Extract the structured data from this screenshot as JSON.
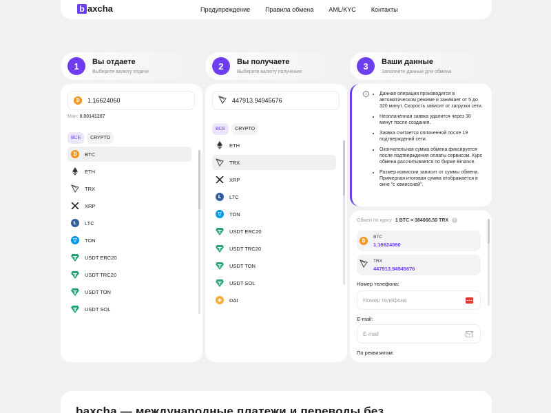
{
  "header": {
    "logo_letter": "b",
    "logo_rest": "axcha",
    "nav": [
      "Предупреждение",
      "Правила обмена",
      "AML/KYC",
      "Контакты"
    ]
  },
  "steps": [
    {
      "num": "1",
      "title": "Вы отдаете",
      "sub": "Выберите валюту отдачи"
    },
    {
      "num": "2",
      "title": "Вы получаете",
      "sub": "Выберите валюту получения"
    },
    {
      "num": "3",
      "title": "Ваши данные",
      "sub": "Заполните данные для обмена"
    }
  ],
  "give": {
    "amount": "1.16624060",
    "min_label": "Мин:",
    "min_value": "0.00141207",
    "filters": [
      "ВСЕ",
      "CRYPTO"
    ],
    "coins": [
      "BTC",
      "ETH",
      "TRX",
      "XRP",
      "LTC",
      "TON",
      "USDT ERC20",
      "USDT TRC20",
      "USDT TON",
      "USDT SOL"
    ]
  },
  "receive": {
    "amount": "447913.94945676",
    "filters": [
      "ВСЕ",
      "CRYPTO"
    ],
    "coins": [
      "ETH",
      "TRX",
      "XRP",
      "LTC",
      "TON",
      "USDT ERC20",
      "USDT TRC20",
      "USDT TON",
      "USDT SOL",
      "DAI"
    ]
  },
  "info": {
    "icon": "i",
    "items": [
      "Данная операция производится в автоматическом режиме и занимает от 5 до 320 минут. Скорость зависит от загрузки сети.",
      "Неоплаченная заявка удалится через 30 минут после создания.",
      "Заявка считается оплаченной после 19 подтверждений сети.",
      "Окончательная сумма обмена фиксируется после подтверждения оплаты сервисом. Курс обмена рассчитывается по бирже Binance.",
      "Размер комиссии зависит от суммы обмена. Примерная итоговая сумма отображается в окне \"с комиссией\"."
    ]
  },
  "summary": {
    "rate_label": "Обмен по курсу",
    "rate_value": "1 BTC = 384066.50 TRX",
    "give_coin": "BTC",
    "give_amount": "1.16624060",
    "get_coin": "TRX",
    "get_amount": "447913.94945676",
    "phone_label": "Номер телефона:",
    "phone_placeholder": "Номер телефона",
    "email_label": "E-mail:",
    "email_placeholder": "E-mail",
    "requisites_label": "По реквизитам:"
  },
  "bottom": {
    "headline": "baxcha — международные платежи и переводы без"
  },
  "colors": {
    "accent": "#6c3ef0",
    "background": "#f1f1f3",
    "btc": "#f7931a",
    "ltc": "#345d9d",
    "ton": "#0098ea",
    "usdt": "#26a17b",
    "dai": "#f5ac37"
  }
}
